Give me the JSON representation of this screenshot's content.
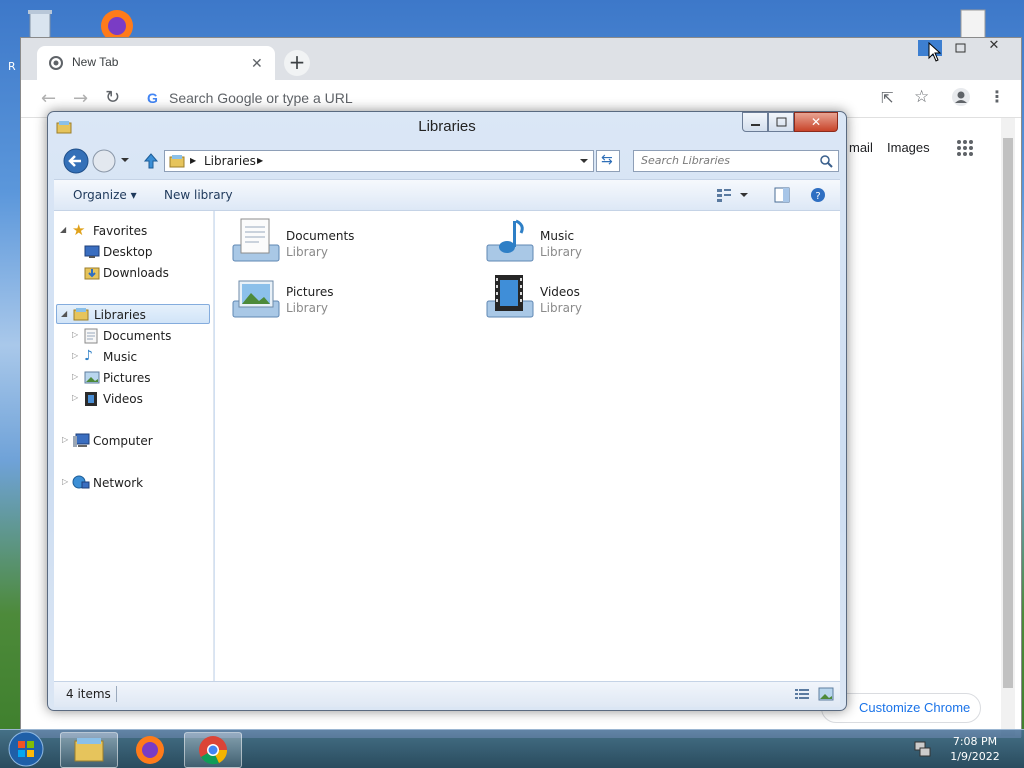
{
  "desktop": {
    "icons": [
      {
        "name": "recycle-bin-icon",
        "label": "R"
      },
      {
        "name": "firefox-desktop-icon",
        "label": ""
      }
    ]
  },
  "chrome": {
    "tab_title": "New Tab",
    "omnibox_placeholder": "Search Google or type a URL",
    "links": {
      "gmail": "mail",
      "images": "Images"
    },
    "customize_label": "Customize Chrome"
  },
  "explorer": {
    "title": "Libraries",
    "address_crumb": "Libraries",
    "search_placeholder": "Search Libraries",
    "commands": {
      "organize": "Organize",
      "new_library": "New library"
    },
    "nav": {
      "favorites": "Favorites",
      "favorites_items": [
        "Desktop",
        "Downloads"
      ],
      "libraries": "Libraries",
      "libraries_items": [
        "Documents",
        "Music",
        "Pictures",
        "Videos"
      ],
      "computer": "Computer",
      "network": "Network"
    },
    "libraries": [
      {
        "name": "Documents",
        "type": "Library",
        "icon": "documents-library-icon"
      },
      {
        "name": "Music",
        "type": "Library",
        "icon": "music-library-icon"
      },
      {
        "name": "Pictures",
        "type": "Library",
        "icon": "pictures-library-icon"
      },
      {
        "name": "Videos",
        "type": "Library",
        "icon": "videos-library-icon"
      }
    ],
    "status": "4 items"
  },
  "taskbar": {
    "pinned": [
      "start-orb-icon",
      "explorer-taskbar-icon",
      "firefox-taskbar-icon",
      "chrome-taskbar-icon"
    ],
    "time": "7:08 PM",
    "date": "1/9/2022"
  },
  "colors": {
    "chrome_accent": "#1a73e8",
    "explorer_frame": "#cdddf1",
    "selection": "#d1e4f8"
  }
}
